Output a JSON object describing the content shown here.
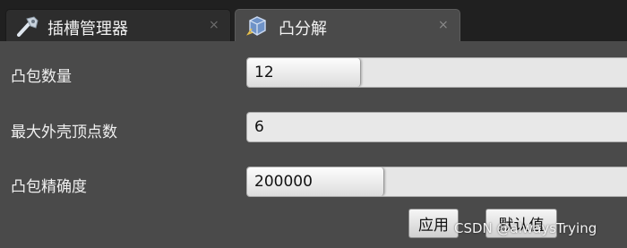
{
  "tabs": [
    {
      "label": "插槽管理器",
      "close": "×",
      "icon": "wrench-icon",
      "active": false
    },
    {
      "label": "凸分解",
      "close": "×",
      "icon": "convex-shape-icon",
      "active": true
    }
  ],
  "rows": [
    {
      "label": "凸包数量",
      "value": "12",
      "level": 0.29
    },
    {
      "label": "最大外壳顶点数",
      "value": "6",
      "level": 0
    },
    {
      "label": "凸包精确度",
      "value": "200000",
      "level": 0.35
    }
  ],
  "buttons": {
    "apply": "应用",
    "default": "默认值"
  },
  "watermark": "CSDN @alwaysTrying",
  "colors": {
    "panel_bg": "#4a4a4a",
    "tabbar_bg": "#202020",
    "field_bg": "#e6e6e6",
    "text_light": "#f0f0f0"
  }
}
